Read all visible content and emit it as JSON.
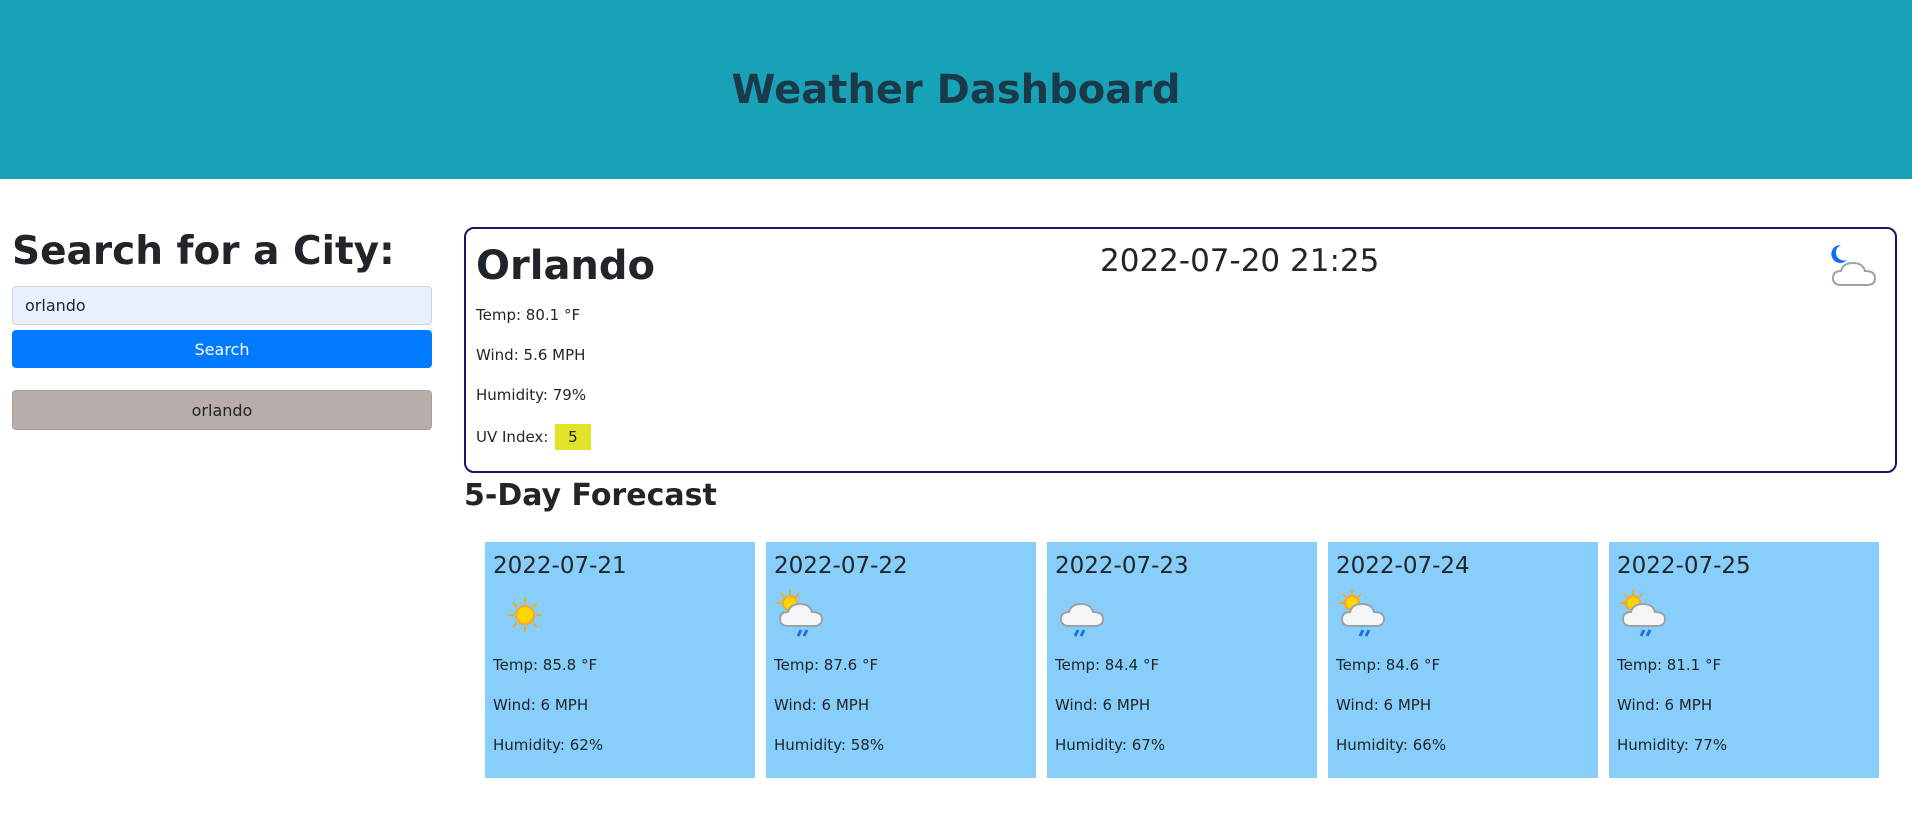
{
  "header": {
    "title": "Weather Dashboard"
  },
  "search": {
    "heading": "Search for a City:",
    "value": "orlando",
    "button_label": "Search",
    "history": [
      "orlando"
    ]
  },
  "current": {
    "city": "Orlando",
    "datetime": "2022-07-20 21:25",
    "icon": "moon-cloud-icon",
    "temp": "Temp: 80.1 °F",
    "wind": "Wind: 5.6 MPH",
    "humidity": "Humidity: 79%",
    "uv_label": "UV Index:",
    "uv_value": "5",
    "uv_color": "#e2e22a"
  },
  "forecast": {
    "title": "5-Day Forecast",
    "days": [
      {
        "date": "2022-07-21",
        "icon": "sun-icon",
        "temp": "Temp: 85.8 °F",
        "wind": "Wind: 6 MPH",
        "humidity": "Humidity: 62%"
      },
      {
        "date": "2022-07-22",
        "icon": "sun-cloud-rain-icon",
        "temp": "Temp: 87.6 °F",
        "wind": "Wind: 6 MPH",
        "humidity": "Humidity: 58%"
      },
      {
        "date": "2022-07-23",
        "icon": "cloud-rain-icon",
        "temp": "Temp: 84.4 °F",
        "wind": "Wind: 6 MPH",
        "humidity": "Humidity: 67%"
      },
      {
        "date": "2022-07-24",
        "icon": "sun-cloud-rain-icon",
        "temp": "Temp: 84.6 °F",
        "wind": "Wind: 6 MPH",
        "humidity": "Humidity: 66%"
      },
      {
        "date": "2022-07-25",
        "icon": "sun-cloud-rain-icon",
        "temp": "Temp: 81.1 °F",
        "wind": "Wind: 6 MPH",
        "humidity": "Humidity: 77%"
      }
    ]
  },
  "colors": {
    "header_bg": "#17a2b8",
    "search_button": "#007bff",
    "history_button": "#b8adab",
    "card_bg": "#87cefa",
    "current_border": "#1b1464"
  }
}
